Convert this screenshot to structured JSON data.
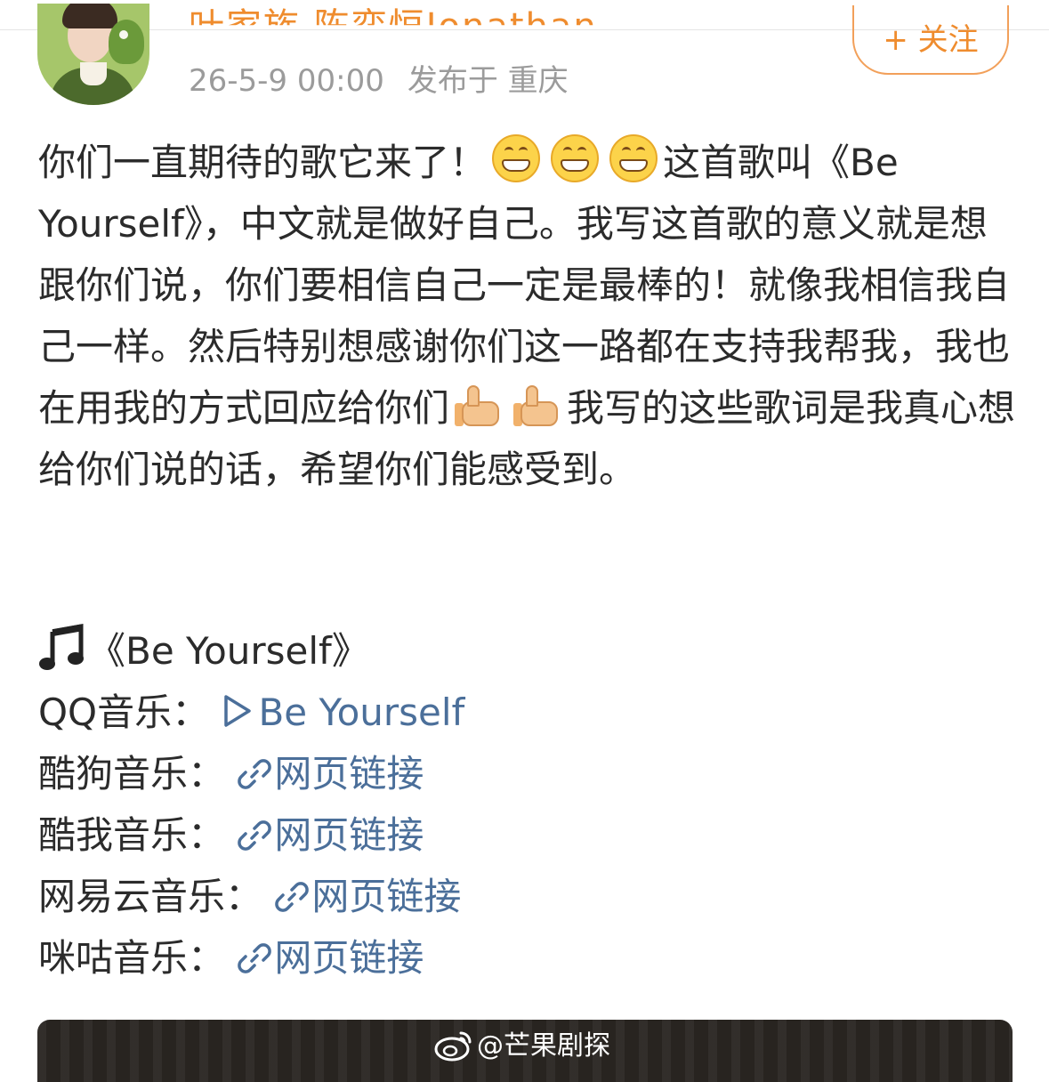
{
  "header": {
    "user_name": "叶家族 陈奕恒Jonathan",
    "timestamp": "26-5-9 00:00",
    "location": "发布于 重庆",
    "follow_label": "+ 关注"
  },
  "post": {
    "text_1": "你们一直期待的歌它来了！",
    "text_2": "这首歌叫《Be Yourself》，中文就是做好自己。我写这首歌的意义就是想跟你们说，你们要相信自己一定是最棒的！就像我相信我自己一样。然后特别想感谢你们这一路都在支持我帮我，我也在用我的方式回应给你们",
    "text_3": "我写的这些歌词是我真心想给你们说的话，希望你们能感受到。"
  },
  "song": {
    "title": "《Be Yourself》",
    "links": [
      {
        "label": "QQ音乐：",
        "link_text": "Be Yourself",
        "icon": "play-icon"
      },
      {
        "label": "酷狗音乐：",
        "link_text": "网页链接",
        "icon": "link-icon"
      },
      {
        "label": "酷我音乐：",
        "link_text": "网页链接",
        "icon": "link-icon"
      },
      {
        "label": "网易云音乐：",
        "link_text": "网页链接",
        "icon": "link-icon"
      },
      {
        "label": "咪咕音乐：",
        "link_text": "网页链接",
        "icon": "link-icon"
      }
    ]
  },
  "watermark": {
    "text": "@芒果剧探"
  },
  "colors": {
    "username": "#ef8c2e",
    "link": "#4b6f9a",
    "meta": "#9b9b9b"
  }
}
